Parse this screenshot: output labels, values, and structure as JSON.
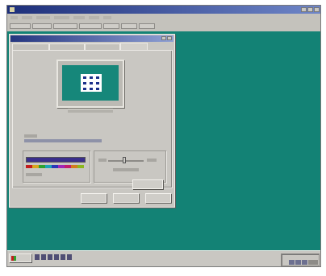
{
  "window": {
    "title": "",
    "menu": [
      "",
      "",
      "",
      "",
      "",
      "",
      ""
    ],
    "toolbar": [
      "",
      "",
      "",
      "",
      "",
      "",
      ""
    ]
  },
  "dialog": {
    "title": "",
    "tabs": [
      "",
      "",
      "",
      ""
    ],
    "labels": {
      "color_palette": "",
      "font_size": "",
      "desktop_area": "",
      "less": "",
      "more": "",
      "resolution": ""
    },
    "buttons": {
      "change_type": "",
      "ok": "",
      "cancel": "",
      "apply": ""
    }
  },
  "taskbar": {
    "start_label": "",
    "clock": ""
  },
  "colors": {
    "desktop": "#138275",
    "title_bar_start": "#1d2f7a",
    "title_bar_end": "#6f86c8",
    "face": "#c9c7c2"
  }
}
